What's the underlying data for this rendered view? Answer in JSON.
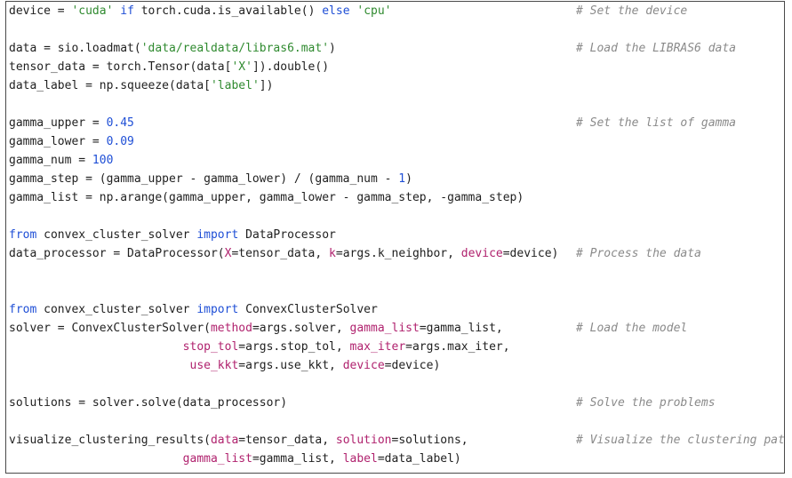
{
  "colors": {
    "keyword": "#1f4fd6",
    "string": "#2f8a2f",
    "number": "#1f4fd6",
    "kwarg": "#b0226e",
    "comment": "#8a8a8a",
    "text": "#1f1f1f"
  },
  "code": {
    "l1": {
      "t1": "device = ",
      "s1": "'cuda'",
      "t2": " ",
      "k1": "if",
      "t3": " torch.cuda.is_available() ",
      "k2": "else",
      "t4": " ",
      "s2": "'cpu'",
      "comment": "# Set the device"
    },
    "l3": {
      "t1": "data = sio.loadmat(",
      "s1": "'data/realdata/libras6.mat'",
      "t2": ")",
      "comment": "# Load the LIBRAS6 data"
    },
    "l4": {
      "t1": "tensor_data = torch.Tensor(data[",
      "s1": "'X'",
      "t2": "]).double()"
    },
    "l5": {
      "t1": "data_label = np.squeeze(data[",
      "s1": "'label'",
      "t2": "])"
    },
    "l7": {
      "t1": "gamma_upper = ",
      "n1": "0.45",
      "comment": "# Set the list of gamma"
    },
    "l8": {
      "t1": "gamma_lower = ",
      "n1": "0.09"
    },
    "l9": {
      "t1": "gamma_num = ",
      "n1": "100"
    },
    "l10": {
      "t1": "gamma_step = (gamma_upper - gamma_lower) / (gamma_num - ",
      "n1": "1",
      "t2": ")"
    },
    "l11": {
      "t1": "gamma_list = np.arange(gamma_upper, gamma_lower - gamma_step, -gamma_step)"
    },
    "l13": {
      "k1": "from",
      "t1": " convex_cluster_solver ",
      "k2": "import",
      "t2": " DataProcessor"
    },
    "l14": {
      "t1": "data_processor = DataProcessor(",
      "a1": "X",
      "t2": "=tensor_data, ",
      "a2": "k",
      "t3": "=args.k_neighbor, ",
      "a3": "device",
      "t4": "=device)",
      "comment": "# Process the data"
    },
    "l17": {
      "k1": "from",
      "t1": " convex_cluster_solver ",
      "k2": "import",
      "t2": " ConvexClusterSolver"
    },
    "l18": {
      "t1": "solver = ConvexClusterSolver(",
      "a1": "method",
      "t2": "=args.solver, ",
      "a2": "gamma_list",
      "t3": "=gamma_list,",
      "comment": "# Load the model"
    },
    "l19": {
      "t0": "                         ",
      "a1": "stop_tol",
      "t1": "=args.stop_tol, ",
      "a2": "max_iter",
      "t2": "=args.max_iter,"
    },
    "l20": {
      "t0": "                          ",
      "a1": "use_kkt",
      "t1": "=args.use_kkt, ",
      "a2": "device",
      "t2": "=device)"
    },
    "l22": {
      "t1": "solutions = solver.solve(data_processor)",
      "comment": "# Solve the problems"
    },
    "l24": {
      "t1": "visualize_clustering_results(",
      "a1": "data",
      "t2": "=tensor_data, ",
      "a2": "solution",
      "t3": "=solutions,",
      "comment": "# Visualize the clustering path"
    },
    "l25": {
      "t0": "                         ",
      "a1": "gamma_list",
      "t1": "=gamma_list, ",
      "a2": "label",
      "t2": "=data_label)"
    }
  }
}
